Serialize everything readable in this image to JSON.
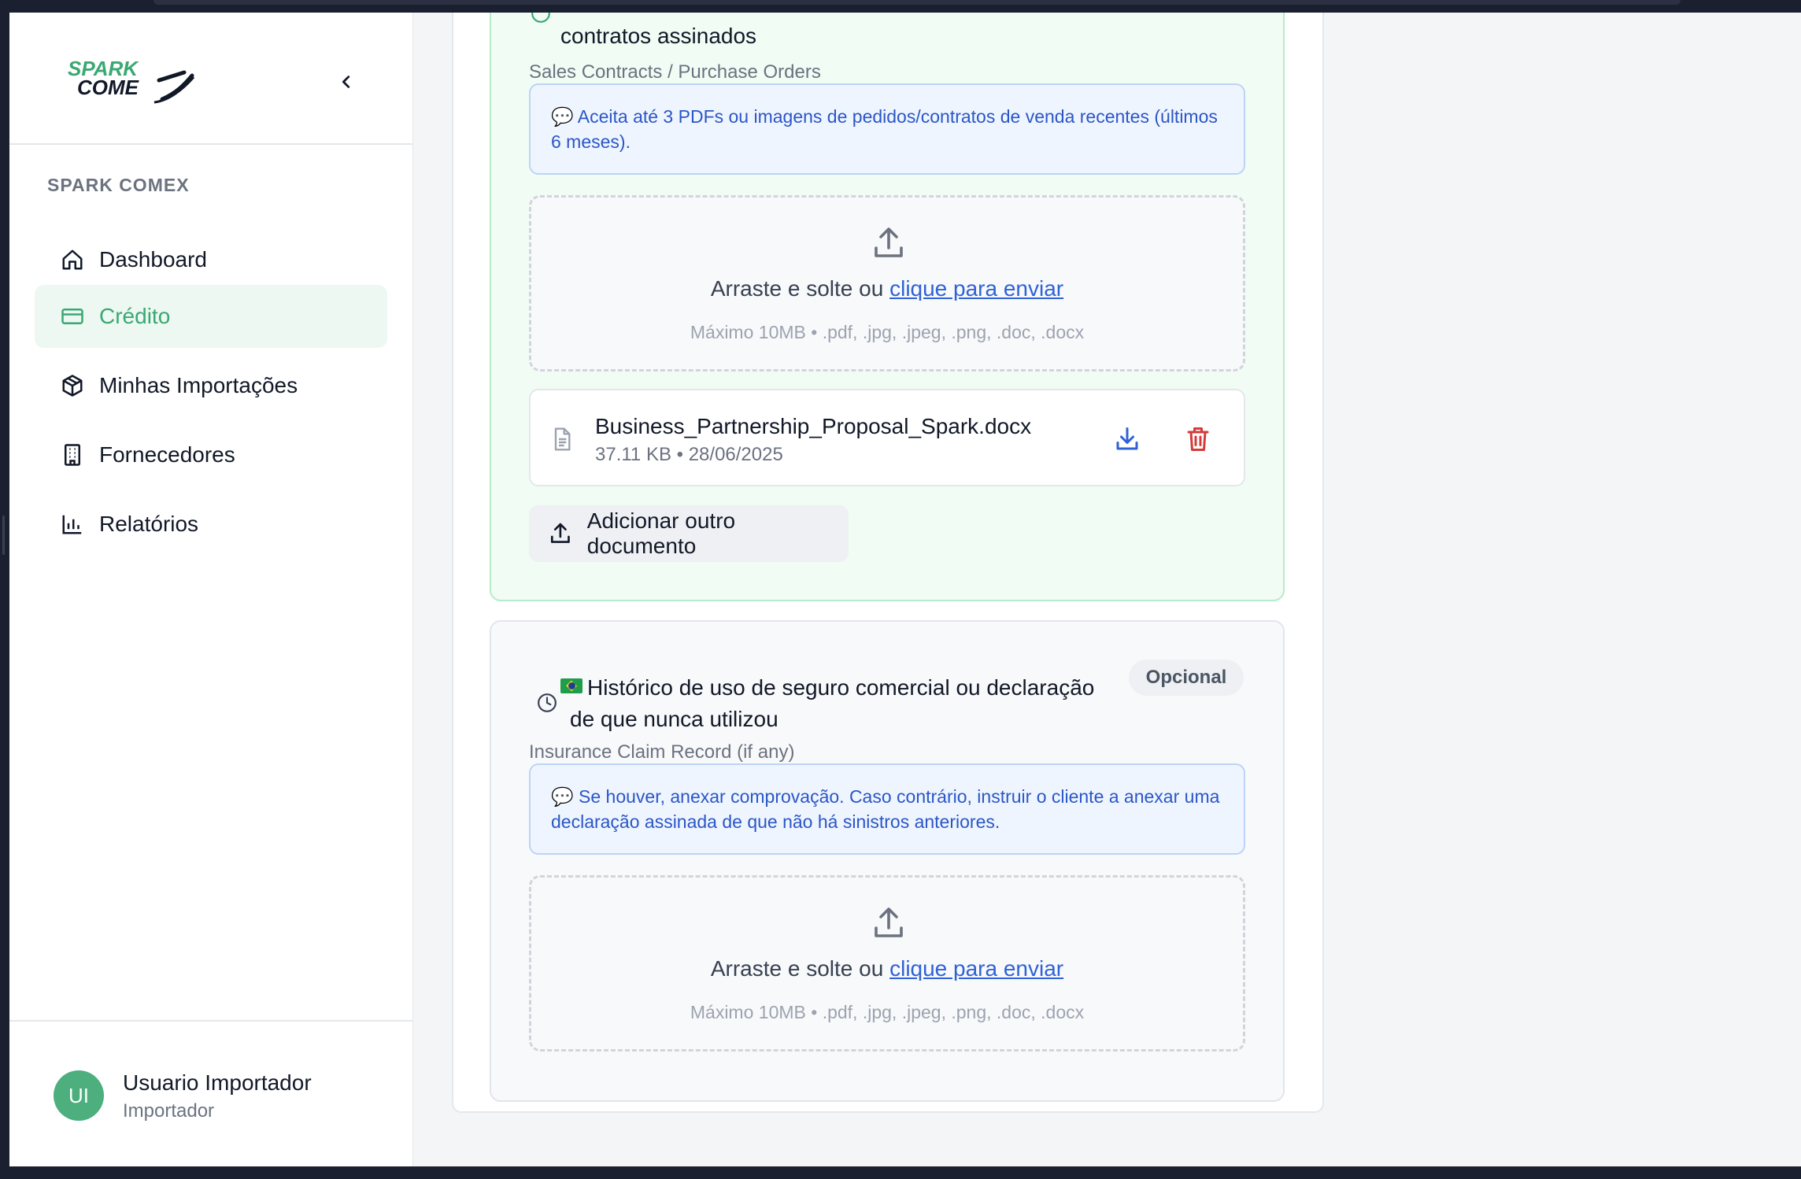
{
  "sidebar": {
    "logo_text": "SPARK COMEX",
    "section_label": "SPARK COMEX",
    "items": [
      {
        "label": "Dashboard",
        "icon": "home-icon",
        "active": false
      },
      {
        "label": "Crédito",
        "icon": "credit-card-icon",
        "active": true
      },
      {
        "label": "Minhas Importações",
        "icon": "package-icon",
        "active": false
      },
      {
        "label": "Fornecedores",
        "icon": "building-icon",
        "active": false
      },
      {
        "label": "Relatórios",
        "icon": "bar-chart-icon",
        "active": false
      }
    ],
    "user": {
      "initials": "UI",
      "name": "Usuario Importador",
      "role": "Importador"
    }
  },
  "cards": [
    {
      "title": "contratos assinados",
      "subtitle": "Sales Contracts / Purchase Orders",
      "info": "💬 Aceita até 3 PDFs ou imagens de pedidos/contratos de venda recentes (últimos 6 meses).",
      "dropzone": {
        "text": "Arraste e solte ou ",
        "link": "clique para enviar",
        "hint": "Máximo 10MB • .pdf, .jpg, .jpeg, .png, .doc, .docx"
      },
      "file": {
        "name": "Business_Partnership_Proposal_Spark.docx",
        "meta": "37.11 KB • 28/06/2025"
      },
      "add_button": "Adicionar outro documento"
    },
    {
      "title_line1": "Histórico de uso de seguro comercial ou declaração",
      "title_line2": "de que nunca utilizou",
      "badge": "Opcional",
      "subtitle": "Insurance Claim Record (if any)",
      "info": "💬 Se houver, anexar comprovação. Caso contrário, instruir o cliente a anexar uma declaração assinada de que não há sinistros anteriores.",
      "dropzone": {
        "text": "Arraste e solte ou ",
        "link": "clique para enviar",
        "hint": "Máximo 10MB • .pdf, .jpg, .jpeg, .png, .doc, .docx"
      }
    }
  ],
  "colors": {
    "accent_green": "#3aa873",
    "link_blue": "#2f62d6",
    "danger_red": "#d43b3b"
  }
}
